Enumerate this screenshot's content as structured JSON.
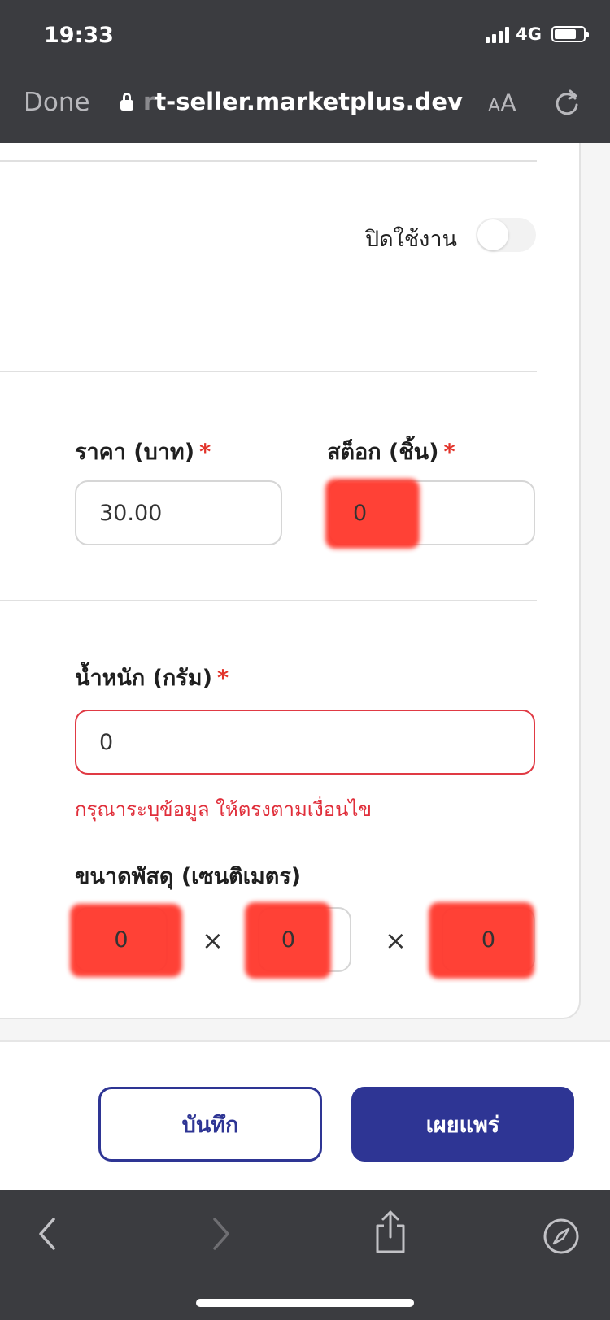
{
  "status_bar": {
    "time": "19:33",
    "network": "4G"
  },
  "browser": {
    "done_label": "Done",
    "url_fade": "r",
    "url_main": "t-seller.marketplus.dev",
    "text_size_small": "A",
    "text_size_big": "A"
  },
  "form": {
    "toggle_label": "ปิดใช้งาน",
    "toggle_on": false,
    "price_label": "ราคา (บาท)",
    "price_value": "30.00",
    "stock_label": "สต็อก (ชิ้น)",
    "stock_value": "0",
    "required_mark": "*",
    "weight_label": "น้ำหนัก (กรัม)",
    "weight_value": "0",
    "weight_error": "กรุณาระบุข้อมูล ให้ตรงตามเงื่อนไข",
    "dimension_label": "ขนาดพัสดุ (เซนติเมตร)",
    "dim_width": "0",
    "dim_length": "0",
    "dim_height": "0",
    "times_symbol": "×"
  },
  "actions": {
    "save_label": "บันทึก",
    "publish_label": "เผยแพร่"
  },
  "colors": {
    "primary": "#2e3594",
    "error": "#e02e3a",
    "bar": "#3b3c40",
    "redaction": "#ff3b30"
  }
}
